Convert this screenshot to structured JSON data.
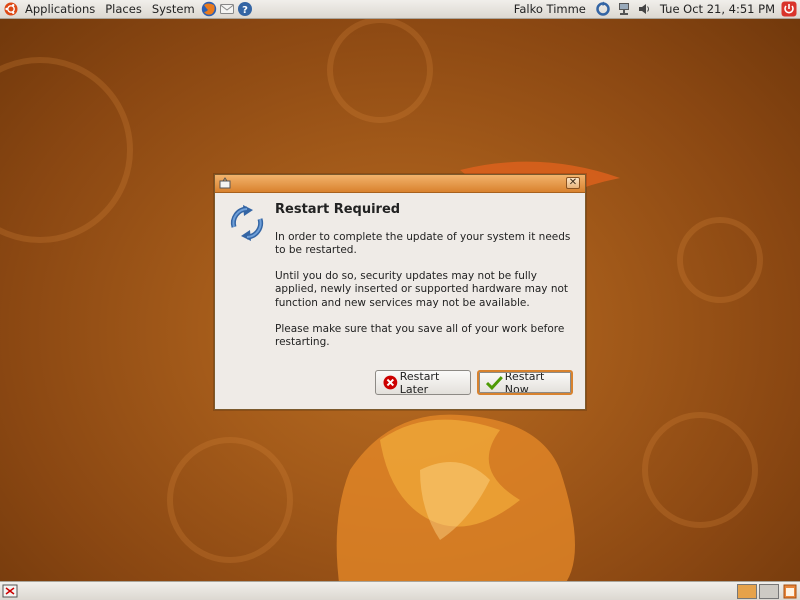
{
  "top_panel": {
    "menus": [
      "Applications",
      "Places",
      "System"
    ],
    "launchers": [
      "firefox-icon",
      "mail-icon",
      "help-icon"
    ],
    "user": "Falko Timme",
    "clock": "Tue Oct 21,  4:51 PM"
  },
  "dialog": {
    "title": "Restart Required",
    "paragraphs": [
      "In order to complete the update of your system it needs to be restarted.",
      "Until you do so, security updates may not be fully applied, newly inserted or supported hardware may not function and new services may not be available.",
      "Please make sure that you save all of your work before restarting."
    ],
    "button_later": "Restart Later",
    "button_now": "Restart Now",
    "icon": "refresh-icon",
    "accent_color": "#d8822e"
  },
  "bottom_panel": {
    "workspaces": 2,
    "active_workspace": 1
  }
}
